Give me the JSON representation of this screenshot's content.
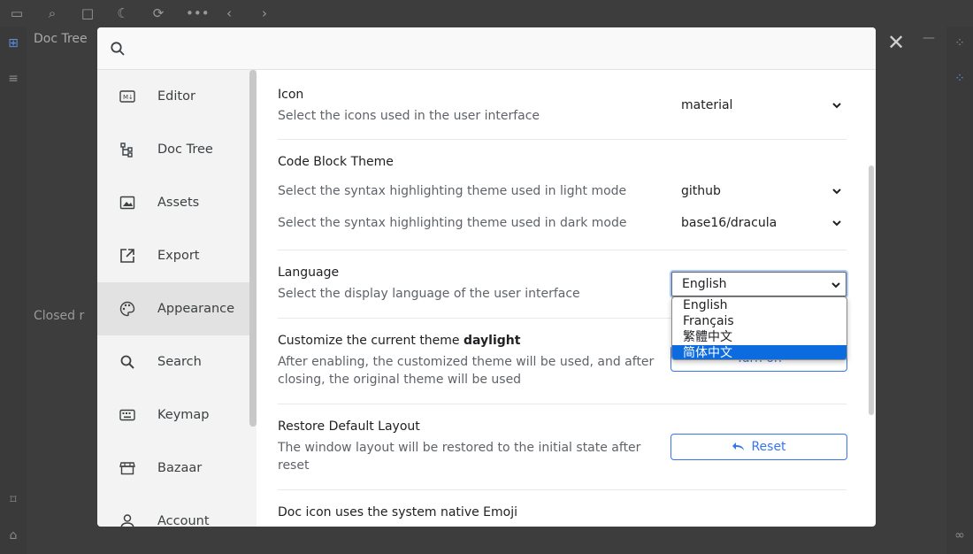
{
  "background": {
    "dock_title": "Doc Tree",
    "closed_label": "Closed r"
  },
  "search": {
    "placeholder": ""
  },
  "nav": {
    "items": [
      {
        "label": "Editor",
        "icon": "markdown-icon"
      },
      {
        "label": "Doc Tree",
        "icon": "doc-tree-icon"
      },
      {
        "label": "Assets",
        "icon": "image-icon"
      },
      {
        "label": "Export",
        "icon": "export-icon"
      },
      {
        "label": "Appearance",
        "icon": "palette-icon",
        "active": true
      },
      {
        "label": "Search",
        "icon": "search-icon"
      },
      {
        "label": "Keymap",
        "icon": "keyboard-icon"
      },
      {
        "label": "Bazaar",
        "icon": "store-icon"
      },
      {
        "label": "Account",
        "icon": "account-icon"
      }
    ]
  },
  "settings": {
    "icon": {
      "title": "Icon",
      "desc": "Select the icons used in the user interface",
      "value": "material"
    },
    "code_block_theme": {
      "title": "Code Block Theme",
      "light_desc": "Select the syntax highlighting theme used in light mode",
      "light_value": "github",
      "dark_desc": "Select the syntax highlighting theme used in dark mode",
      "dark_value": "base16/dracula"
    },
    "language": {
      "title": "Language",
      "desc": "Select the display language of the user interface",
      "value": "English"
    },
    "customize_theme": {
      "title_prefix": "Customize the current theme",
      "theme_name": "daylight",
      "desc": "After enabling, the customized theme will be used, and after closing, the original theme will be used",
      "button": "Turn on"
    },
    "restore_layout": {
      "title": "Restore Default Layout",
      "desc": "The window layout will be restored to the initial state after reset",
      "button": "Reset"
    },
    "native_emoji": {
      "title": "Doc icon uses the system native Emoji"
    }
  },
  "language_dropdown": {
    "options": [
      "English",
      "Français",
      "繁體中文",
      "简体中文"
    ],
    "highlighted": "简体中文"
  },
  "colors": {
    "accent": "#3575f0",
    "highlight": "#0c6bde",
    "active_nav": "#e2e2e2"
  }
}
